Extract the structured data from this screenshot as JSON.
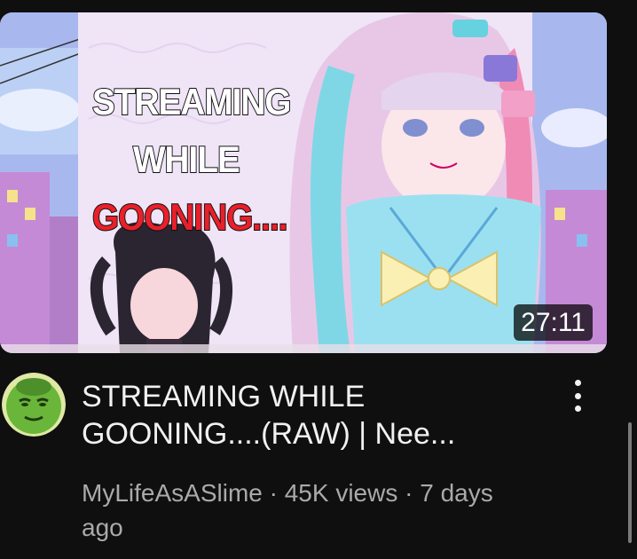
{
  "video": {
    "thumbnail": {
      "overlay_line1": "STREAMING",
      "overlay_line2": "WHILE",
      "overlay_line3": "GOONING....",
      "overlay_colors": {
        "line1": "#ffffff",
        "line2": "#ffffff",
        "line3": "#e8202a"
      },
      "duration": "27:11"
    },
    "title": "STREAMING WHILE GOONING....(RAW)  | Nee...",
    "meta": "MyLifeAsASlime · 45K views · 7 days ago",
    "channel_avatar": {
      "icon": "green-face-avatar-icon",
      "color": "#6ab63a"
    },
    "menu_icon": "more-vertical-icon"
  },
  "colors": {
    "background": "#0f0f0f",
    "title_text": "#f1f1f1",
    "meta_text": "#aaaaaa"
  }
}
